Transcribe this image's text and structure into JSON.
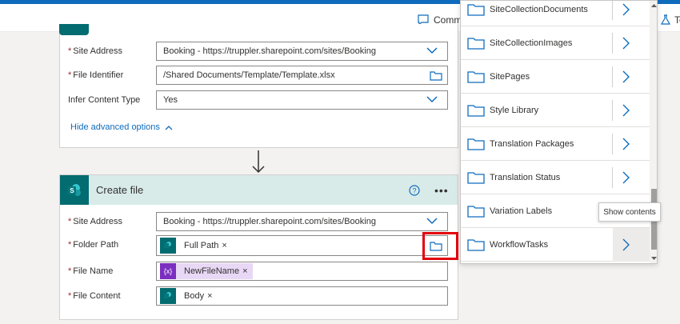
{
  "commands": {
    "comments_label": "Comm",
    "test_label": "Te"
  },
  "card1": {
    "fields": [
      {
        "label": "Site Address",
        "required": true,
        "value": "Booking - https://truppler.sharepoint.com/sites/Booking",
        "control": "dropdown"
      },
      {
        "label": "File Identifier",
        "required": true,
        "value": "/Shared Documents/Template/Template.xlsx",
        "control": "folder"
      },
      {
        "label": "Infer Content Type",
        "required": false,
        "value": "Yes",
        "control": "dropdown"
      }
    ],
    "hide_advanced": "Hide advanced options"
  },
  "card2": {
    "title": "Create file",
    "help_icon": "help-circle-icon",
    "more_icon": "ellipsis-icon",
    "site_address": {
      "label": "Site Address",
      "value": "Booking - https://truppler.sharepoint.com/sites/Booking"
    },
    "folder_path": {
      "label": "Folder Path",
      "token": "Full Path"
    },
    "file_name": {
      "label": "File Name",
      "token": "NewFileName",
      "token_icon": "{x}"
    },
    "file_content": {
      "label": "File Content",
      "token": "Body"
    },
    "remove": "×",
    "required_mark": "*"
  },
  "dropdown": {
    "items": [
      {
        "name": "SiteCollectionDocuments"
      },
      {
        "name": "SiteCollectionImages"
      },
      {
        "name": "SitePages"
      },
      {
        "name": "Style Library"
      },
      {
        "name": "Translation Packages"
      },
      {
        "name": "Translation Status"
      },
      {
        "name": "Variation Labels"
      },
      {
        "name": "WorkflowTasks"
      }
    ],
    "tooltip": "Show contents"
  },
  "colors": {
    "accent": "#0f6cbd",
    "sharepoint": "#036c70",
    "expression": "#7b2fbf",
    "highlight": "#e3000b",
    "header_bg": "#d8ebe9"
  }
}
